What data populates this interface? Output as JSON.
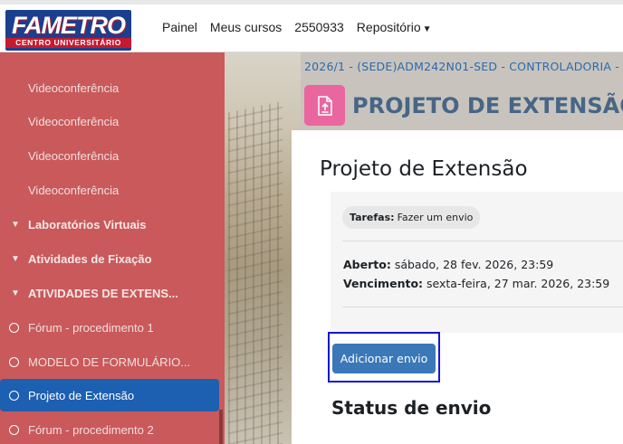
{
  "header": {
    "logo_main": "FAMETRO",
    "logo_sub": "CENTRO UNIVERSITÁRIO",
    "nav": [
      "Painel",
      "Meus cursos",
      "2550933",
      "Repositório"
    ]
  },
  "sidebar": {
    "items": [
      {
        "label": "Videoconferência"
      },
      {
        "label": "Videoconferência"
      },
      {
        "label": "Videoconferência"
      },
      {
        "label": "Videoconferência"
      },
      {
        "label": "Laboratórios Virtuais"
      },
      {
        "label": "Atividades de Fixação"
      },
      {
        "label": "ATIVIDADES DE EXTENS..."
      },
      {
        "label": "Fórum - procedimento 1"
      },
      {
        "label": "MODELO DE FORMULÁRIO..."
      },
      {
        "label": "Projeto de Extensão"
      },
      {
        "label": "Fórum - procedimento 2"
      }
    ]
  },
  "main": {
    "breadcrumb": "2026/1 - (SEDE)ADM242N01-SED - CONTROLADORIA -",
    "page_title": "PROJETO DE EXTENSÃO",
    "heading": "Projeto de Extensão",
    "badge_label": "Tarefas:",
    "badge_value": "Fazer um envio",
    "opened_label": "Aberto:",
    "opened_value": "sábado, 28 fev. 2026, 23:59",
    "due_label": "Vencimento:",
    "due_value": "sexta-feira, 27 mar. 2026, 23:59",
    "add_submission_button": "Adicionar envio",
    "status_heading": "Status de envio"
  },
  "colors": {
    "sidebar_bg": "#c9595b",
    "active_item": "#1d5fb0",
    "accent_blue": "#3a78b8",
    "module_icon": "#e9669f"
  }
}
